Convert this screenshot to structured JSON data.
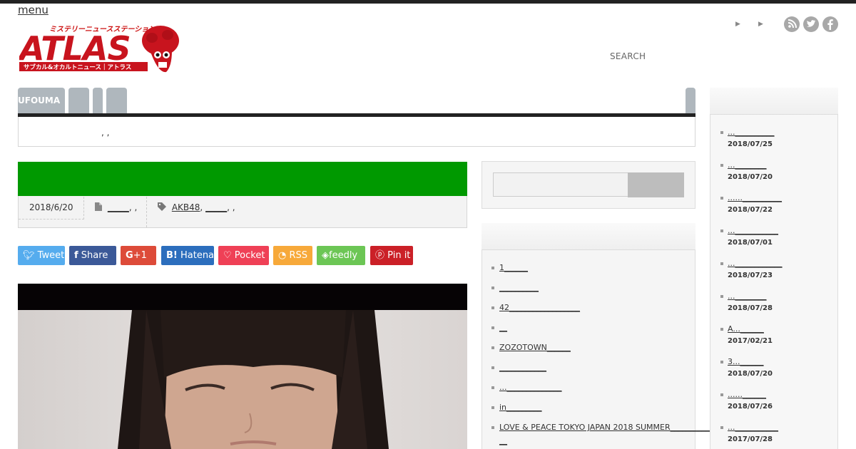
{
  "header": {
    "menu_label": "menu",
    "logo_top_text": "ミステリーニュースステーション",
    "logo_main_text": "ATLAS",
    "logo_bottom_text": "サブカル&オカルトニュース｜アトラス",
    "search_label": "SEARCH",
    "social_icons": [
      "rss-icon",
      "twitter-icon",
      "facebook-icon"
    ]
  },
  "nav": {
    "tabs": [
      {
        "label": "UFOUMA"
      },
      {
        "label": ""
      },
      {
        "label": ""
      },
      {
        "label": ""
      },
      {
        "label": ""
      }
    ]
  },
  "breadcrumb": {
    "text": ", ,"
  },
  "article": {
    "header_color": "#009900",
    "date": "2018/6/20",
    "category_link": "_____",
    "category_suffix": ", ,",
    "tags": {
      "first": "AKB48",
      "second": "_____",
      "suffix": ", ,"
    }
  },
  "share_buttons": [
    {
      "label": "Tweet",
      "icon": "twitter-icon",
      "color": "#55acee"
    },
    {
      "label": "Share",
      "icon": "facebook-icon",
      "color": "#3b5998"
    },
    {
      "label": "+1",
      "icon": "google-plus-icon",
      "color": "#dd4b39"
    },
    {
      "label": "Hatena",
      "icon": "hatena-icon",
      "color": "#2c6ebd"
    },
    {
      "label": "Pocket",
      "icon": "pocket-icon",
      "color": "#ef4056"
    },
    {
      "label": "RSS",
      "icon": "rss-icon",
      "color": "#f7a93a"
    },
    {
      "label": "feedly",
      "icon": "feedly-icon",
      "color": "#6cc655"
    },
    {
      "label": "Pin it",
      "icon": "pinterest-icon",
      "color": "#cb2027"
    }
  ],
  "sidebar_list": {
    "items": [
      "1______",
      "__________",
      "42__________________",
      "__",
      "ZOZOTOWN______",
      "____________",
      "...______________",
      "in_________",
      "LOVE & PEACE TOKYO JAPAN 2018 SUMMER_______________",
      "__"
    ]
  },
  "ranking": {
    "items": [
      {
        "title": "...__________",
        "date": "2018/07/25"
      },
      {
        "title": "...________",
        "date": "2018/07/20"
      },
      {
        "title": "......__________",
        "date": "2018/07/22"
      },
      {
        "title": "...___________",
        "date": "2018/07/01"
      },
      {
        "title": "...____________",
        "date": "2018/07/23"
      },
      {
        "title": "...________",
        "date": "2018/07/28"
      },
      {
        "title": "A...______",
        "date": "2017/02/21"
      },
      {
        "title": "3...______",
        "date": "2018/07/20"
      },
      {
        "title": "......______",
        "date": "2018/07/26"
      },
      {
        "title": "...___________",
        "date": "2017/07/28"
      }
    ]
  }
}
